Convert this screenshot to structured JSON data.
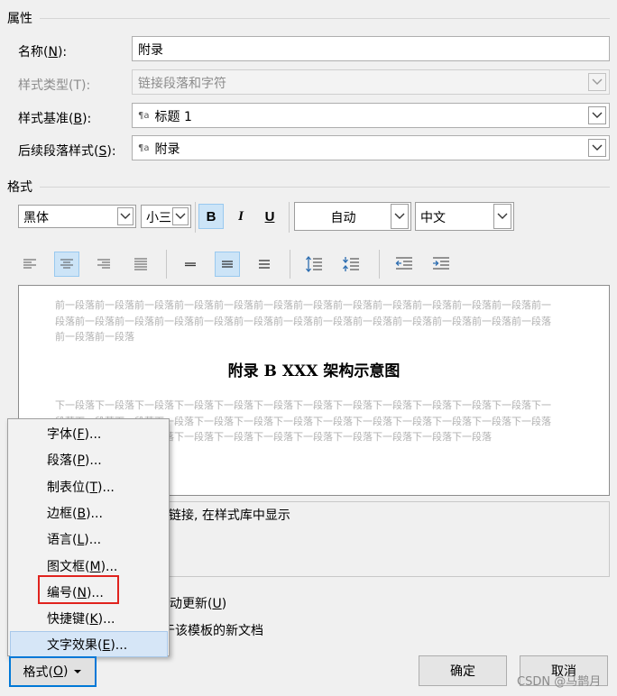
{
  "properties": {
    "section_title": "属性",
    "name_label": "名称(",
    "name_key": "N",
    "name_tail": "):",
    "name_value": "附录",
    "style_type_label": "样式类型(T):",
    "style_type_value": "链接段落和字符",
    "based_on_label_a": "样式基准(",
    "based_on_key": "B",
    "based_on_label_b": "):",
    "based_on_value": "标题 1",
    "following_label_a": "后续段落样式(",
    "following_key": "S",
    "following_label_b": "):",
    "following_value": "附录",
    "style_icon": "¶a"
  },
  "format": {
    "section_title": "格式",
    "font_latin": "黑体",
    "font_size": "小三",
    "bold": "B",
    "italic": "I",
    "underline": "U",
    "color": "自动",
    "language": "中文"
  },
  "paragraph_toolbar": {
    "icons": [
      "align-left-icon",
      "align-center-icon",
      "align-right-icon",
      "justify-icon",
      "single-spacing-icon",
      "one-half-spacing-icon",
      "double-spacing-icon",
      "increase-paragraph-spacing-icon",
      "decrease-paragraph-spacing-icon",
      "decrease-indent-icon",
      "increase-indent-icon"
    ],
    "active": [
      "align-center-icon",
      "one-half-spacing-icon"
    ]
  },
  "preview": {
    "previous_text": "前一段落前一段落前一段落前一段落前一段落前一段落前一段落前一段落前一段落前一段落前一段落前一段落前一段落前一段落前一段落前一段落前一段落前一段落前一段落前一段落前一段落前一段落前一段落前一段落前一段落前一段落前一段落",
    "heading": "附录 B XXX 架构示意图",
    "next_text": "下一段落下一段落下一段落下一段落下一段落下一段落下一段落下一段落下一段落下一段落下一段落下一段落下一段落下一段落下一段落下一段落下一段落下一段落下一段落下一段落下一段落下一段落下一段落下一段落下一段落下一段落下一段落下一段落下一段落下一段落下一段落下一段落下一段落下一段落下一段落下一段落"
  },
  "description": "链接, 在样式库中显示",
  "options": {
    "auto_update_tail": "动更新(",
    "auto_update_key": "U",
    "auto_update_end": ")",
    "new_docs_tail": "于该模板的新文档"
  },
  "menu": {
    "items": [
      {
        "text": "字体(",
        "key": "F",
        "end": ")..."
      },
      {
        "text": "段落(",
        "key": "P",
        "end": ")..."
      },
      {
        "text": "制表位(",
        "key": "T",
        "end": ")..."
      },
      {
        "text": "边框(",
        "key": "B",
        "end": ")..."
      },
      {
        "text": "语言(",
        "key": "L",
        "end": ")..."
      },
      {
        "text": "图文框(",
        "key": "M",
        "end": ")..."
      },
      {
        "text": "编号(",
        "key": "N",
        "end": ")..."
      },
      {
        "text": "快捷键(",
        "key": "K",
        "end": ")..."
      },
      {
        "text": "文字效果(",
        "key": "E",
        "end": ")..."
      }
    ],
    "highlighted_index": 8,
    "boxed_index": 6
  },
  "buttons": {
    "format_a": "格式(",
    "format_key": "O",
    "format_b": ")",
    "ok": "确定",
    "cancel": "取消"
  },
  "watermark": "CSDN @马鹊月",
  "colors": {
    "accent_blue": "#0078d7",
    "highlight": "#cce4f7",
    "red_box": "#e0231e"
  }
}
